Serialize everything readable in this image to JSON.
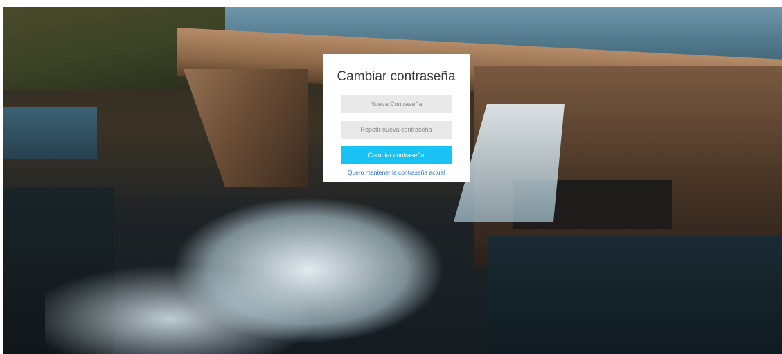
{
  "background": {
    "image_name": "hydroelectric-dam-photo"
  },
  "card": {
    "title": "Cambiar contraseña",
    "new_password": {
      "placeholder": "Nueva Contraseña",
      "value": ""
    },
    "repeat_password": {
      "placeholder": "Repetir nueva contraseña",
      "value": ""
    },
    "submit_label": "Cambiar contraseña",
    "keep_link_label": "Quero mantener la contraseña actual"
  },
  "colors": {
    "accent": "#18c3f3",
    "link": "#2a6fd6",
    "input_bg": "#e9e9e9",
    "card_bg": "#ffffff"
  }
}
